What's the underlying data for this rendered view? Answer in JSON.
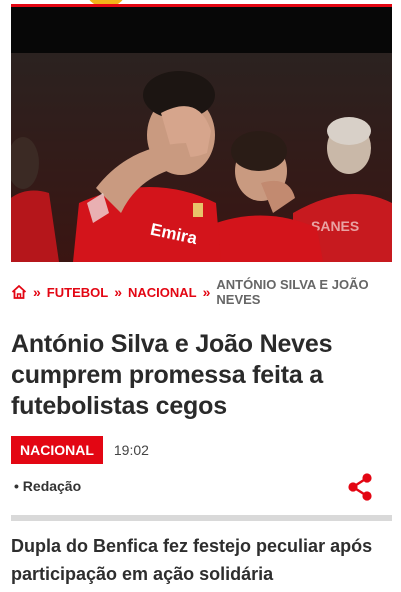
{
  "breadcrumb": {
    "home_icon": "home-icon",
    "separator": "»",
    "items": [
      "FUTEBOL",
      "NACIONAL",
      "ANTÓNIO SILVA E JOÃO NEVES"
    ]
  },
  "article": {
    "headline": "António Silva e João Neves cumprem promessa feita a futebolistas cegos",
    "category_tag": "NACIONAL",
    "time": "19:02",
    "author": "• Redação",
    "share_icon": "share-icon",
    "lead": "Dupla do Benfica fez festejo peculiar após participação em ação solidária"
  },
  "colors": {
    "accent": "#e30613",
    "jersey_red": "#d3141b",
    "divider": "#d9d9d9"
  }
}
